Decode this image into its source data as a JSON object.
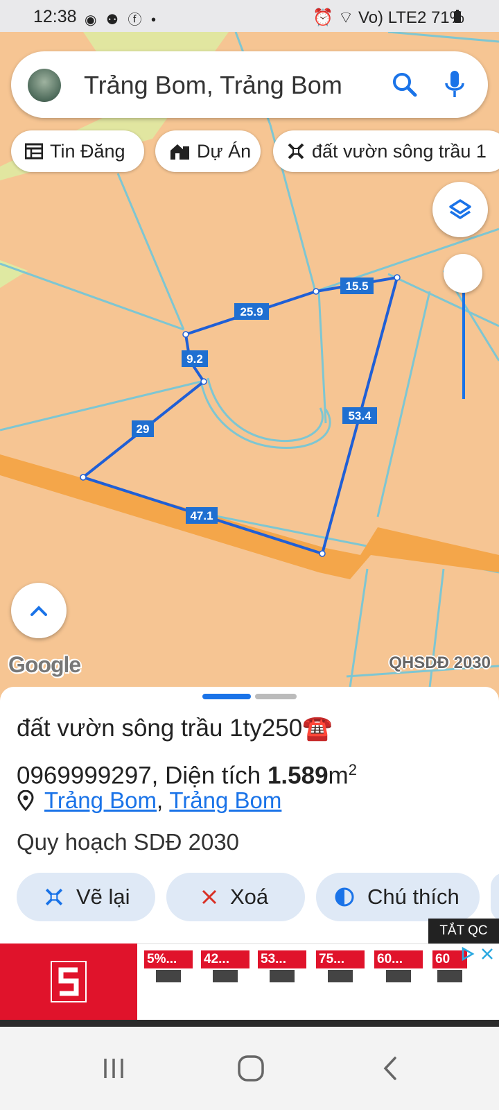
{
  "status_bar": {
    "time": "12:38",
    "notification_icons": "◉ ⚉ ⓕ •",
    "right_text": "⏰ ⌔ Vo) LTE2 71%"
  },
  "search": {
    "query": "Trảng Bom, Trảng Bom"
  },
  "chips": [
    {
      "label": "Tin Đăng",
      "icon": "listing-icon"
    },
    {
      "label": "Dự Án",
      "icon": "building-icon"
    },
    {
      "label": "đất vườn sông trầu 1",
      "icon": "ruler-icon"
    }
  ],
  "map": {
    "segment_lengths": [
      "15.5",
      "25.9",
      "9.2",
      "29",
      "53.4",
      "47.1"
    ],
    "logo": "Google",
    "layer_label": "QHSDĐ 2030",
    "colors": {
      "land": "#f6c593",
      "parcel_line": "#7ec6d2",
      "road": "#f4a64a",
      "boundary": "#1f5fd6"
    }
  },
  "listing": {
    "title_part1": "đất vườn sông trầu 1ty250☎️",
    "phone": "0969999297",
    "area_label": ", Diện tích ",
    "area_value": "1.589",
    "area_unit": "m",
    "area_exp": "2",
    "location_part1": "Trảng Bom",
    "location_sep": ", ",
    "location_part2": "Trảng Bom",
    "planning": "Quy hoạch SDĐ 2030"
  },
  "actions": [
    {
      "label": "Vẽ lại",
      "icon": "ruler-icon"
    },
    {
      "label": "Xoá",
      "icon": "close-icon"
    },
    {
      "label": "Chú thích",
      "icon": "contrast-icon"
    }
  ],
  "ad": {
    "close_label": "TẮT QC",
    "products": [
      "5%...",
      "42...",
      "53...",
      "75...",
      "60...",
      "60"
    ]
  }
}
